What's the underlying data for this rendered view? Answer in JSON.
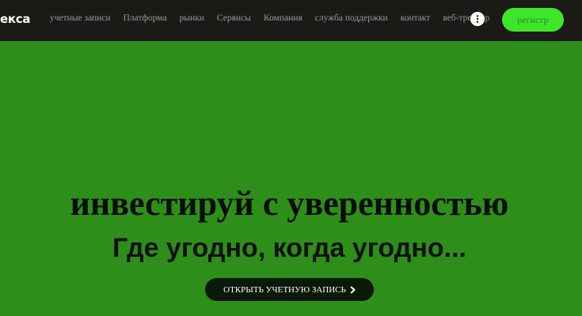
{
  "header": {
    "logo_text": "екса",
    "nav": [
      "учетные записи",
      "Платформа",
      "рынки",
      "Сервисы",
      "Компания",
      "служба поддержки",
      "контакт",
      "веб-трейдер"
    ],
    "more_icon": "vertical-dots-icon",
    "register_label": "регистр"
  },
  "hero": {
    "title": "инвестируй с уверенностью",
    "subtitle": "Где угодно, когда угодно...",
    "cta_label": "ОТКРЫТЬ УЧЕТНУЮ ЗАПИСЬ",
    "cta_icon": "chevron-right-icon"
  },
  "colors": {
    "nav_background": "#1b1a17",
    "hero_background": "#2d8f1a",
    "accent_green": "#3ee62a",
    "cta_background": "#0b1a08"
  }
}
